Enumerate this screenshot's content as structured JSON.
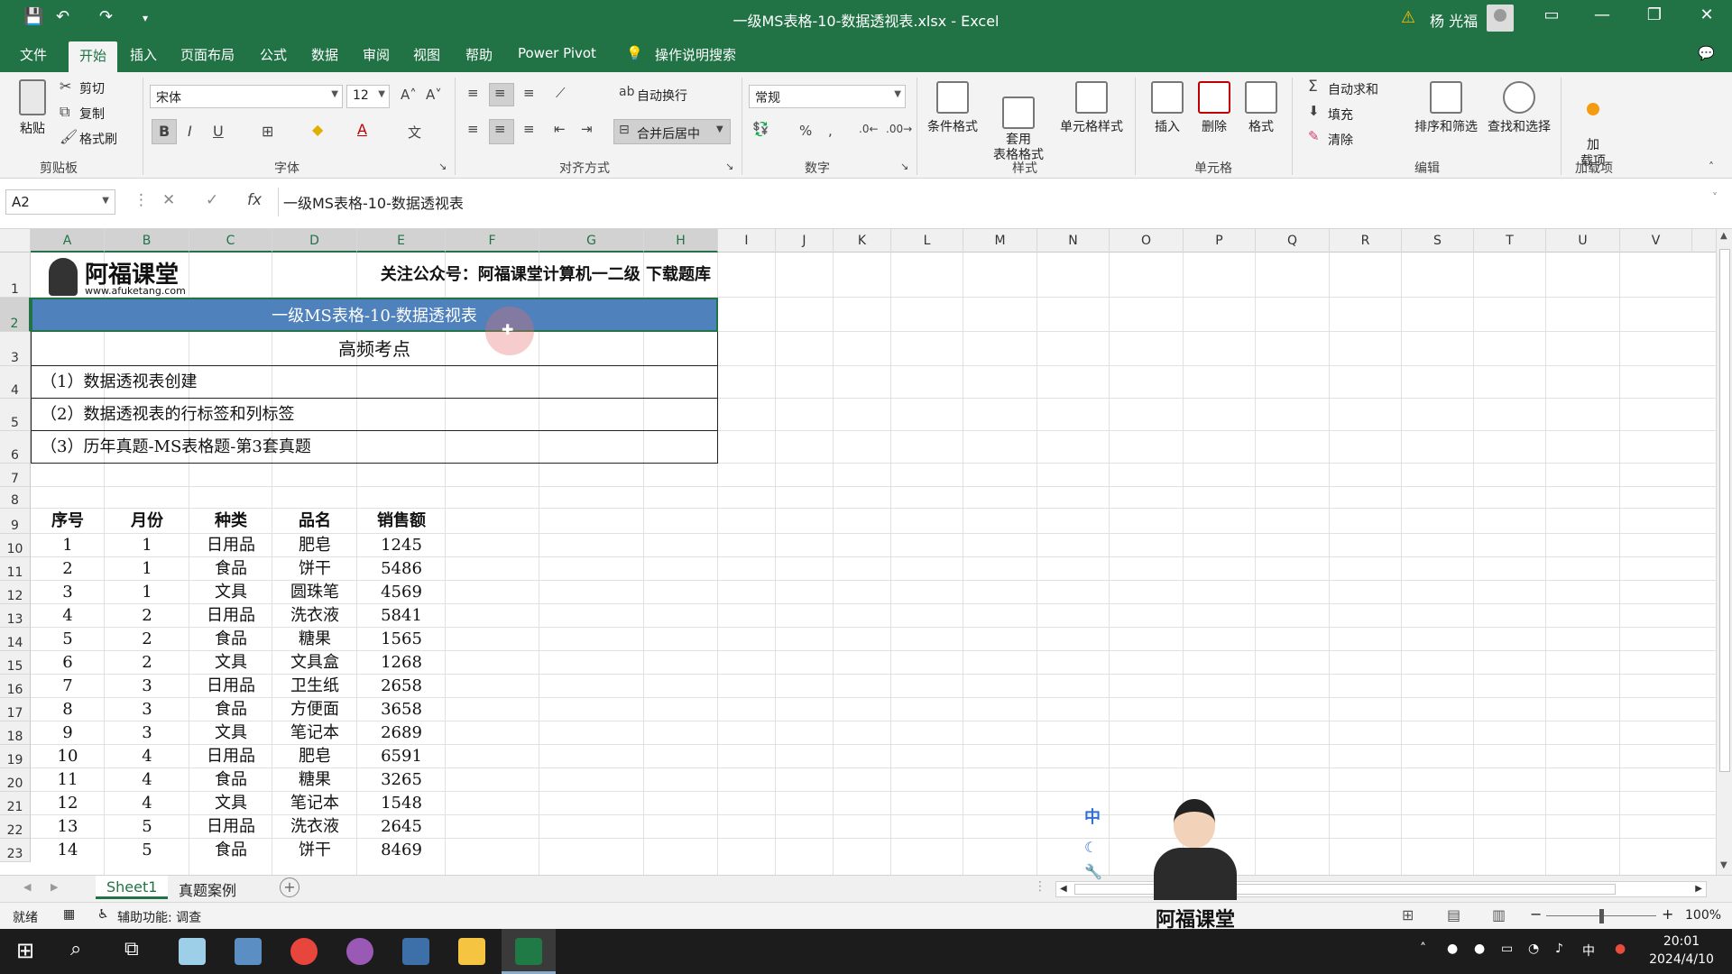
{
  "window": {
    "title": "一级MS表格-10-数据透视表.xlsx  -  Excel",
    "user": "杨 光福"
  },
  "menu": {
    "tabs": [
      "文件",
      "开始",
      "插入",
      "页面布局",
      "公式",
      "数据",
      "审阅",
      "视图",
      "帮助",
      "Power Pivot"
    ],
    "search": "操作说明搜索"
  },
  "ribbon": {
    "clipboard": {
      "paste": "粘贴",
      "cut": "剪切",
      "copy": "复制",
      "format_painter": "格式刷",
      "label": "剪贴板"
    },
    "font": {
      "name": "宋体",
      "size": "12",
      "label": "字体"
    },
    "alignment": {
      "wrap": "自动换行",
      "merge": "合并后居中",
      "label": "对齐方式"
    },
    "number": {
      "format": "常规",
      "label": "数字"
    },
    "styles": {
      "conditional": "条件格式",
      "table": "套用\n表格格式",
      "cell_styles": "单元格样式",
      "label": "样式"
    },
    "cells": {
      "insert": "插入",
      "delete": "删除",
      "format": "格式",
      "label": "单元格"
    },
    "editing": {
      "autosum": "自动求和",
      "fill": "填充",
      "clear": "清除",
      "sort": "排序和筛选",
      "find": "查找和选择",
      "label": "编辑"
    },
    "addins": {
      "addin": "加\n载项",
      "label": "加载项"
    }
  },
  "formula_bar": {
    "name_box": "A2",
    "content": "一级MS表格-10-数据透视表"
  },
  "sheet": {
    "columns": [
      "A",
      "B",
      "C",
      "D",
      "E",
      "F",
      "G",
      "H",
      "I",
      "J",
      "K",
      "L",
      "M",
      "N",
      "O",
      "P",
      "Q",
      "R",
      "S",
      "T",
      "U",
      "V"
    ],
    "rows": [
      "1",
      "2",
      "3",
      "4",
      "5",
      "6",
      "7",
      "8",
      "9",
      "10",
      "11",
      "12",
      "13",
      "14",
      "15",
      "16",
      "17",
      "18",
      "19",
      "20",
      "21",
      "22",
      "23"
    ],
    "logo_text": "阿福课堂",
    "logo_url": "www.afuketang.com",
    "notice": "关注公众号：阿福课堂计算机一二级  下载题库",
    "banner": "一级MS表格-10-数据透视表",
    "section_title": "高频考点",
    "points": [
      "（1）数据透视表创建",
      "（2）数据透视表的行标签和列标签",
      "（3）历年真题-MS表格题-第3套真题"
    ],
    "table_headers": [
      "序号",
      "月份",
      "种类",
      "品名",
      "销售额"
    ],
    "table_rows": [
      [
        "1",
        "1",
        "日用品",
        "肥皂",
        "1245"
      ],
      [
        "2",
        "1",
        "食品",
        "饼干",
        "5486"
      ],
      [
        "3",
        "1",
        "文具",
        "圆珠笔",
        "4569"
      ],
      [
        "4",
        "2",
        "日用品",
        "洗衣液",
        "5841"
      ],
      [
        "5",
        "2",
        "食品",
        "糖果",
        "1565"
      ],
      [
        "6",
        "2",
        "文具",
        "文具盒",
        "1268"
      ],
      [
        "7",
        "3",
        "日用品",
        "卫生纸",
        "2658"
      ],
      [
        "8",
        "3",
        "食品",
        "方便面",
        "3658"
      ],
      [
        "9",
        "3",
        "文具",
        "笔记本",
        "2689"
      ],
      [
        "10",
        "4",
        "日用品",
        "肥皂",
        "6591"
      ],
      [
        "11",
        "4",
        "食品",
        "糖果",
        "3265"
      ],
      [
        "12",
        "4",
        "文具",
        "笔记本",
        "1548"
      ],
      [
        "13",
        "5",
        "日用品",
        "洗衣液",
        "2645"
      ],
      [
        "14",
        "5",
        "食品",
        "饼干",
        "8469"
      ]
    ]
  },
  "sheet_tabs": [
    "Sheet1",
    "真题案例"
  ],
  "status": {
    "ready": "就绪",
    "accessibility": "辅助功能: 调查",
    "zoom": "100%"
  },
  "overlay": {
    "watermark": "阿福课堂",
    "ime": "中"
  },
  "taskbar": {
    "time": "20:01",
    "date": "2024/4/10",
    "ime": "中"
  },
  "colors": {
    "excel_green": "#217346",
    "banner_blue": "#4f81bd"
  }
}
